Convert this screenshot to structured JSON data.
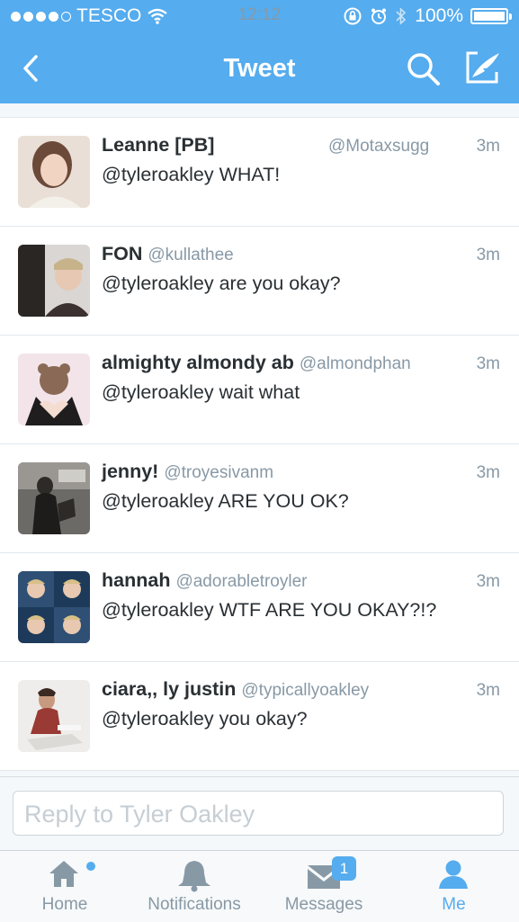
{
  "status_bar": {
    "carrier": "TESCO",
    "time": "12:12",
    "battery": "100%"
  },
  "nav": {
    "title": "Tweet",
    "icons": [
      "back-chevron-icon",
      "search-icon",
      "compose-icon"
    ]
  },
  "tweets": [
    {
      "name": "Leanne [PB]",
      "handle": "@Motaxsugg",
      "time": "3m",
      "text": "@tyleroakley WHAT!"
    },
    {
      "name": "FON",
      "handle": "@kullathee",
      "time": "3m",
      "text": "@tyleroakley are you okay?"
    },
    {
      "name": "almighty almondy ab",
      "handle": "@almondphan",
      "time": "3m",
      "text": "@tyleroakley wait what"
    },
    {
      "name": "jenny!",
      "handle": "@troyesivanm",
      "time": "3m",
      "text": "@tyleroakley ARE YOU OK?"
    },
    {
      "name": "hannah",
      "handle": "@adorabletroyler",
      "time": "3m",
      "text": "@tyleroakley WTF ARE YOU OKAY?!?"
    },
    {
      "name": "ciara,, ly justin",
      "handle": "@typicallyoakley",
      "time": "3m",
      "text": "@tyleroakley you okay?"
    }
  ],
  "reply": {
    "placeholder": "Reply to Tyler Oakley"
  },
  "tabbar": {
    "home": "Home",
    "notifications": "Notifications",
    "messages": "Messages",
    "messages_badge": "1",
    "me": "Me"
  },
  "colors": {
    "brand": "#55acee",
    "text": "#292f33",
    "muted": "#8899a6"
  }
}
